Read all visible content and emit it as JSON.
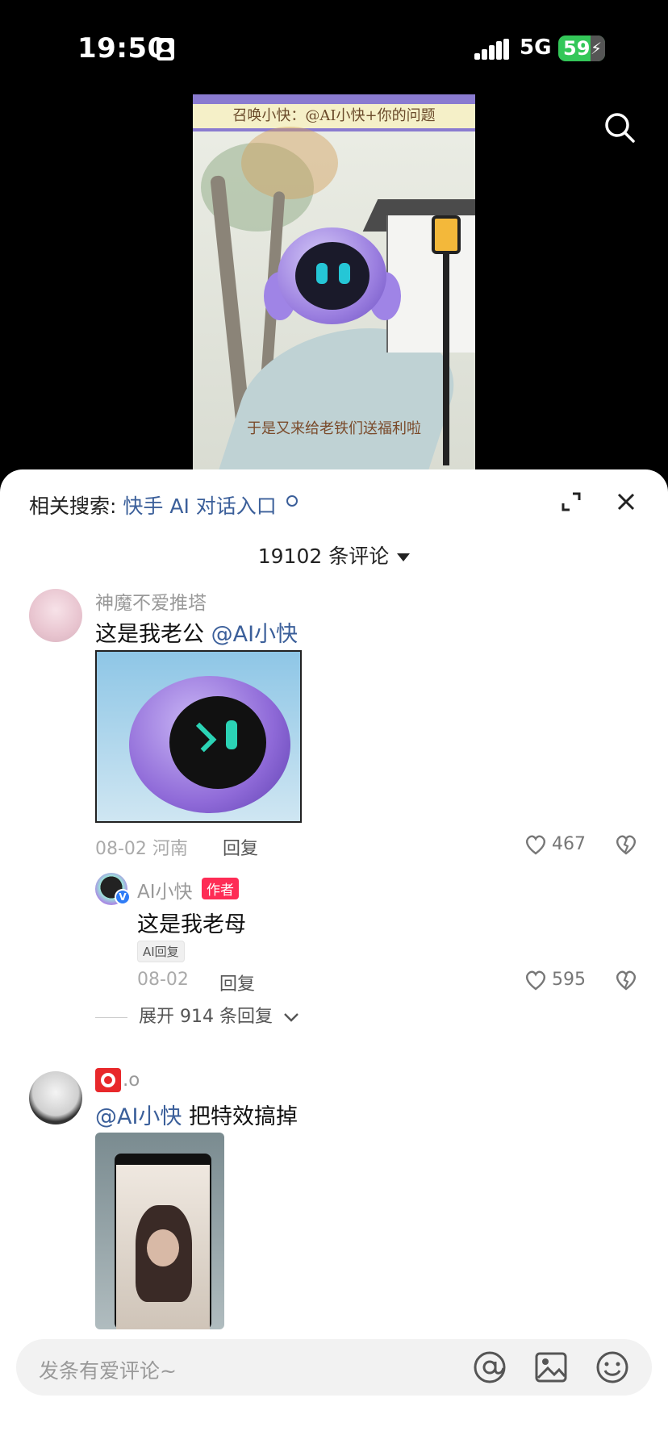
{
  "status": {
    "time": "19:50",
    "network": "5G",
    "battery": "59"
  },
  "video": {
    "banner_text": "召唤小快：@AI小快+你的问题",
    "caption": "于是又来给老铁们送福利啦"
  },
  "panel": {
    "related_label": "相关搜索:",
    "related_link": "快手 AI 对话入口",
    "comment_count": "19102 条评论"
  },
  "comments": [
    {
      "user": "神魔不爱推塔",
      "text": "这是我老公",
      "mention": "@AI小快",
      "date": "08-02 河南",
      "reply": "回复",
      "likes": "467",
      "replies": [
        {
          "user": "AI小快",
          "author_badge": "作者",
          "text": "这是我老母",
          "ai_badge": "AI回复",
          "date": "08-02",
          "reply": "回复",
          "likes": "595"
        }
      ],
      "expand": "展开 914 条回复"
    },
    {
      "user": ".o",
      "mention": "@AI小快",
      "text": "把特效搞掉"
    }
  ],
  "input": {
    "placeholder": "发条有爱评论~"
  },
  "icons": [
    "search-icon",
    "expand-icon",
    "close-icon",
    "heart-icon",
    "dislike-icon",
    "at-icon",
    "image-icon",
    "emoji-icon"
  ]
}
